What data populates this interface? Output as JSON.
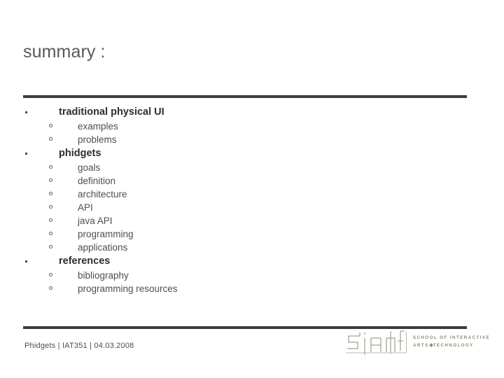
{
  "slide": {
    "title": "summary :",
    "footer": "Phidgets  |  IAT351  |  04.03.2008",
    "rule_color": "#3e3e42",
    "title_color": "#58585a"
  },
  "outline": [
    {
      "label": "traditional physical UI",
      "children": [
        {
          "label": "examples"
        },
        {
          "label": "problems"
        }
      ]
    },
    {
      "label": "phidgets",
      "children": [
        {
          "label": "goals"
        },
        {
          "label": "definition"
        },
        {
          "label": "architecture"
        },
        {
          "label": "API"
        },
        {
          "label": "java API"
        },
        {
          "label": "programming"
        },
        {
          "label": "applications"
        }
      ]
    },
    {
      "label": "references",
      "children": [
        {
          "label": "bibliography"
        },
        {
          "label": "programming resources"
        }
      ]
    }
  ],
  "logo": {
    "mark_alt": "siat",
    "line1": "SCHOOL OF INTERACTIVE",
    "line2_before": "ARTS",
    "line2_after": "TECHNOLOGY",
    "color": "#8b8b72"
  }
}
